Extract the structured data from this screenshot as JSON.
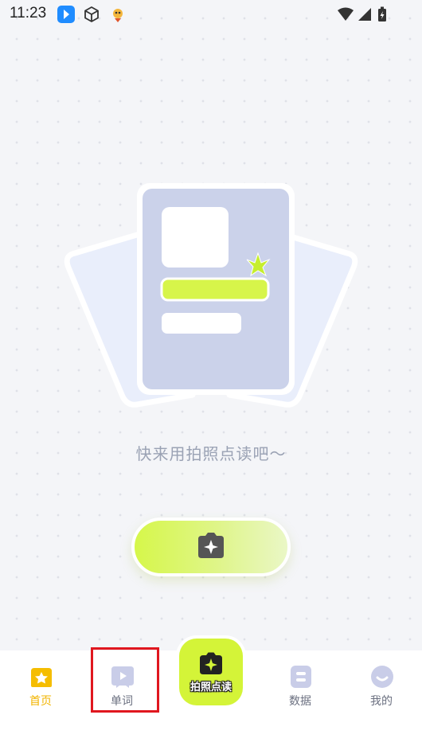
{
  "status_bar": {
    "time": "11:23",
    "icons": [
      "app-blue-icon",
      "cube-icon",
      "rocket-mascot-icon",
      "wifi-icon",
      "cellular-signal-icon",
      "battery-charging-icon"
    ]
  },
  "main": {
    "caption": "快来用拍照点读吧～",
    "scan_button_icon": "camera-sparkle-icon"
  },
  "tabbar": {
    "tabs": [
      {
        "label": "首页",
        "icon": "home-icon",
        "active": true
      },
      {
        "label": "单词",
        "icon": "video-play-icon",
        "active": false
      },
      {
        "label": "拍照点读",
        "icon": "camera-sparkle-icon",
        "active": false
      },
      {
        "label": "数据",
        "icon": "data-icon",
        "active": false
      },
      {
        "label": "我的",
        "icon": "profile-face-icon",
        "active": false
      }
    ]
  },
  "colors": {
    "accent_lime": "#d4f438",
    "active_tab": "#f2b400",
    "highlight": "#e0171f",
    "inactive_icon": "#c9cde8"
  }
}
